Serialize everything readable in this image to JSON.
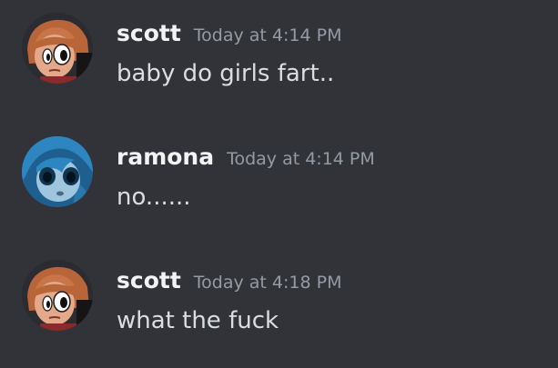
{
  "messages": [
    {
      "author": "scott",
      "timestamp": "Today at 4:14 PM",
      "content": "baby do girls fart..",
      "avatar_icon": "scott-avatar-icon"
    },
    {
      "author": "ramona",
      "timestamp": "Today at 4:14 PM",
      "content": "no......",
      "avatar_icon": "ramona-avatar-icon"
    },
    {
      "author": "scott",
      "timestamp": "Today at 4:18 PM",
      "content": "what the fuck",
      "avatar_icon": "scott-avatar-icon"
    }
  ],
  "colors": {
    "background": "#313338",
    "username": "#f2f3f5",
    "timestamp": "#949ba4",
    "content": "#dbdee1"
  }
}
